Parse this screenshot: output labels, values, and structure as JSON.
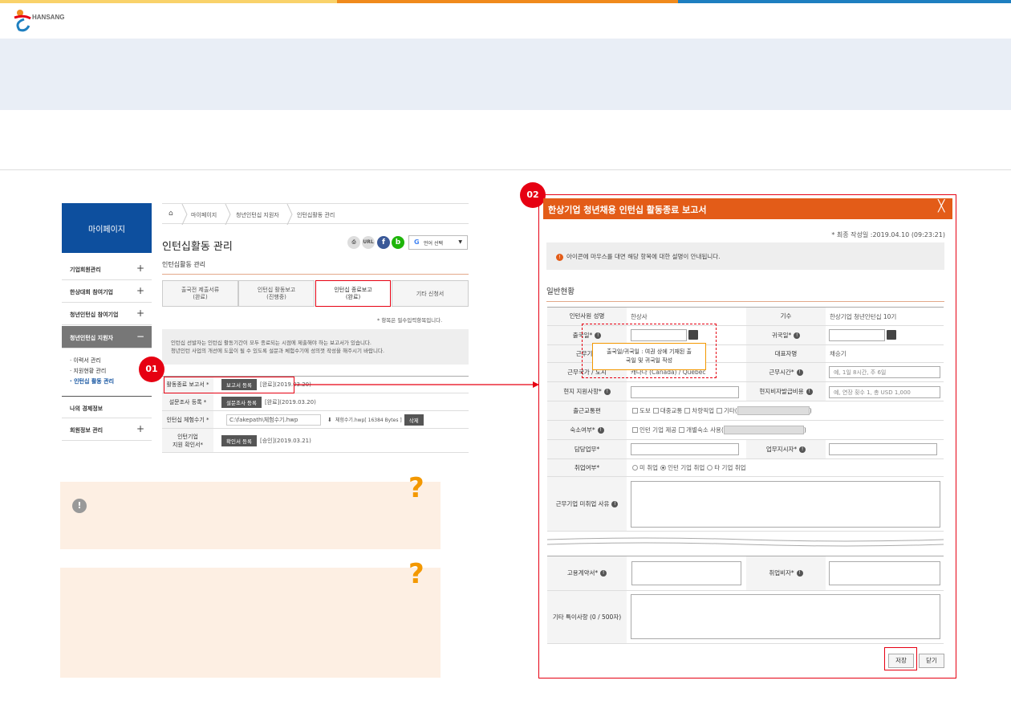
{
  "brand": {
    "logo_text": "HANSANG",
    "accent_colors": [
      "#f9d26a",
      "#f08a1c",
      "#1e7fc0"
    ]
  },
  "left": {
    "sidebar": {
      "title": "마이페이지",
      "items": [
        {
          "label": "기업회원관리",
          "toggle": "+"
        },
        {
          "label": "한상대회 참여기업",
          "toggle": "+"
        },
        {
          "label": "청년인턴십 참여기업",
          "toggle": "+"
        },
        {
          "label": "청년인턴십 지원자",
          "toggle": "−"
        }
      ],
      "sub_items": [
        "· 이력서 관리",
        "· 지원현황 관리",
        "· 인턴십 활동 관리"
      ],
      "items2": [
        {
          "label": "나의 경제정보",
          "toggle": ""
        },
        {
          "label": "회원정보 관리",
          "toggle": "+"
        }
      ]
    },
    "breadcrumb": [
      "마이페이지",
      "청년인턴십 지원자",
      "인턴십활동 관리"
    ],
    "page_title": "인턴십활동 관리",
    "share": {
      "url_label": "URL",
      "facebook": "f",
      "blog": "b",
      "language": "언어 선택",
      "language_icon": "G"
    },
    "subtitle": "인턴십활동 관리",
    "tabs": [
      {
        "line1": "출국전 제출서류",
        "line2": "(완료)"
      },
      {
        "line1": "인턴십 활동보고",
        "line2": "(진행중)"
      },
      {
        "line1": "인턴십 종료보고",
        "line2": "(완료)"
      },
      {
        "line1": "기타 신청서",
        "line2": ""
      }
    ],
    "required_note": "* 항목은 필수입력항목입니다.",
    "info": {
      "line1": "인턴십 선발자는 인턴십 활동기간이 모두 종료되는 시점에 제출해야 하는 보고서가 있습니다.",
      "line2": "청년인턴 사업의 개선에 도움이 될 수 있도록 설문과 체험수기에 성의껏 작성을 해주시기 바랍니다."
    },
    "rows": [
      {
        "label": "활동종료 보고서 *",
        "button": "보고서 등록",
        "status": "[완료](2019.03.20)"
      },
      {
        "label": "설문조사 등록 *",
        "button": "설문조사 등록",
        "status": "[완료](2019.03.20)"
      },
      {
        "label": "인턴십 체험수기 *",
        "file_path": "C:\\fakepath\\체험수기.hwp",
        "file_info": "체험수기.hwp[ 16384 Bytes ]",
        "delete": "삭제"
      },
      {
        "label_line1": "인턴기업",
        "label_line2": "지원 확인서*",
        "button": "확인서 등록",
        "status": "[승인](2019.03.21)"
      }
    ],
    "badge": "01"
  },
  "notes": [
    {
      "icon": "!",
      "qmark": "?"
    },
    {
      "qmark": "?"
    }
  ],
  "modal": {
    "badge": "02",
    "title": "한상기업 청년채용 인턴십 활동종료 보고서",
    "close": "╳",
    "last_edit": "* 최종 작성일 :2019.04.10 (09:23:21)",
    "notice_icon": "!",
    "notice": "아이콘에 마우스를 대면 해당 항목에 대한 설명이 안내됩니다.",
    "section": "일반현황",
    "fields": {
      "name_label": "인턴사원 성명",
      "name_value": "한상사",
      "cohort_label": "기수",
      "cohort_value": "한상기업 청년인턴십 10기",
      "depart_label": "출국일*",
      "return_label": "귀국일*",
      "company_label": "근무기업",
      "rep_label": "대표자명",
      "rep_value": "채승기",
      "country_label": "근무국가 / 도시",
      "country_value": "캐나다 (Canada) / Quebec",
      "hours_label": "근무시간*",
      "hours_placeholder": "예, 1일 8시간, 주 6일",
      "support_label": "현지 지원사항*",
      "visa_cost_label": "현지비자발급비용",
      "visa_cost_placeholder": "예, 연장 횟수 1, 총 USD 1,000",
      "commute_label": "출근교통편",
      "commute_options": [
        "도보",
        "대중교통",
        "차량픽업",
        "기타("
      ],
      "commute_close": ")",
      "housing_label": "숙소여부*",
      "housing_options": [
        "인턴 기업 제공",
        "개별숙소 사용("
      ],
      "housing_close": ")",
      "duty_label": "담당업무*",
      "duty_instr_label": "업무지시자*",
      "employ_label": "취업여부*",
      "employ_options": [
        "미 취업",
        "인턴 기업 취업",
        "타 기업 취업"
      ],
      "reason_label": "근무기업 미취업 사유",
      "contract_label": "고용계약서*",
      "work_visa_label": "취업비자*",
      "etc_label": "기타 특이사항 (0 / 500자)"
    },
    "tooltip": {
      "line1": "출국일/귀국일 : 여권 상에 기재된 출",
      "line2": "국일 및 귀국일 작성"
    },
    "save": "저장",
    "close_btn": "닫기"
  }
}
